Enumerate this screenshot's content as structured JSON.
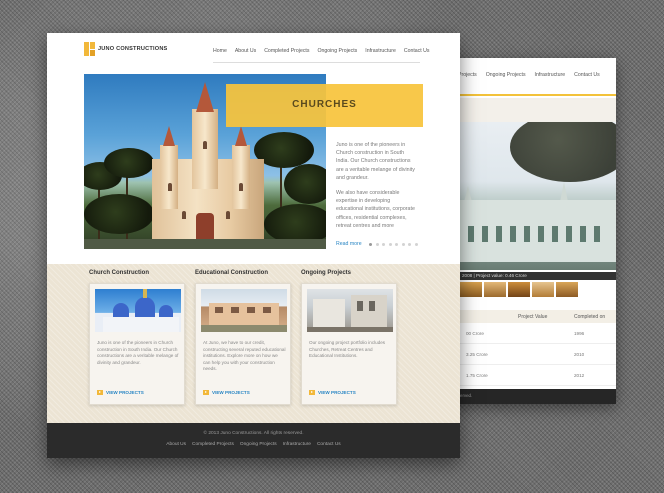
{
  "brand": {
    "name": "JUNO CONSTRUCTIONS"
  },
  "nav": {
    "items": [
      "Home",
      "About Us",
      "Completed Projects",
      "Ongoing Projects",
      "Infrastructure",
      "Contact Us"
    ]
  },
  "hero": {
    "banner_title": "CHURCHES",
    "paragraph_1": "Juno is one of the pioneers in Church construction in South India. Our Church constructions are a veritable melange of divinity and grandeur.",
    "paragraph_2": "We also have considerable expertise in developing educational institutions, corporate offices, residential complexes, retreat centres and more",
    "read_more": "Read more",
    "slide_count": 8,
    "active_slide": 1
  },
  "features": [
    {
      "heading": "Church Construction",
      "text": "Juno is one of the pioneers in Church construction in South India. Our Church constructions are a veritable melange of divinity and grandeur.",
      "link": "VIEW PROJECTS"
    },
    {
      "heading": "Educational Construction",
      "text": "At Juno, we have to our credit, constructing several reputed educational institutions. Explore more on how we can help you with your construction needs.",
      "link": "VIEW PROJECTS"
    },
    {
      "heading": "Ongoing Projects",
      "text": "Our ongoing project portfolio includes Churches, Retreat Centres and Educational Institutions.",
      "link": "VIEW PROJECTS"
    }
  ],
  "footer": {
    "copyright": "© 2013 Juno Constructions. All rights reserved.",
    "links": [
      "About Us",
      "Completed Projects",
      "Ongoing Projects",
      "Infrastructure",
      "Contact Us"
    ]
  },
  "back_page": {
    "nav": [
      "Projects",
      "Ongoing Projects",
      "Infrastructure",
      "Contact Us"
    ],
    "caption": "2008 | Project value: 0.46 Crore",
    "table": {
      "headers": [
        "Project Value",
        "Completed on"
      ],
      "rows": [
        [
          "00 Crore",
          "1996"
        ],
        [
          "3.25 Crore",
          "2010"
        ],
        [
          "1.75 Crore",
          "2012"
        ]
      ]
    },
    "footer_copy": "erved.",
    "footer_links": [
      "structure",
      "Contact Us"
    ]
  },
  "colors": {
    "accent": "#f8c43c",
    "link": "#2a86c4",
    "footer_bg": "#2b2b2b",
    "features_bg": "#ece4d4"
  }
}
